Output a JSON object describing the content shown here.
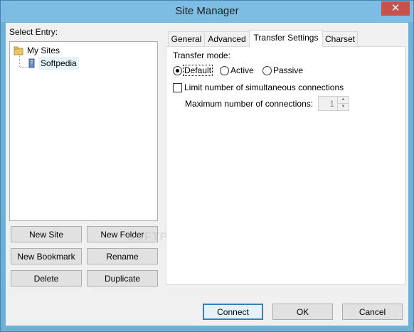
{
  "window": {
    "title": "Site Manager",
    "close_glyph": "✕"
  },
  "left": {
    "select_entry_label": "Select Entry:",
    "tree": [
      {
        "label": "My Sites",
        "icon": "folder-icon"
      },
      {
        "label": "Softpedia",
        "icon": "server-icon"
      }
    ],
    "buttons": {
      "new_site": "New Site",
      "new_folder": "New Folder",
      "new_bookmark": "New Bookmark",
      "rename": "Rename",
      "delete": "Delete",
      "duplicate": "Duplicate"
    }
  },
  "tabs": [
    {
      "label": "General"
    },
    {
      "label": "Advanced"
    },
    {
      "label": "Transfer Settings",
      "active": true
    },
    {
      "label": "Charset"
    }
  ],
  "transfer": {
    "mode_label": "Transfer mode:",
    "modes": [
      {
        "label": "Default",
        "selected": true
      },
      {
        "label": "Active",
        "selected": false
      },
      {
        "label": "Passive",
        "selected": false
      }
    ],
    "limit_label": "Limit number of simultaneous connections",
    "limit_checked": false,
    "max_label": "Maximum number of connections:",
    "max_value": "1"
  },
  "footer": {
    "connect": "Connect",
    "ok": "OK",
    "cancel": "Cancel"
  },
  "watermark": "SOFTPEDIA"
}
